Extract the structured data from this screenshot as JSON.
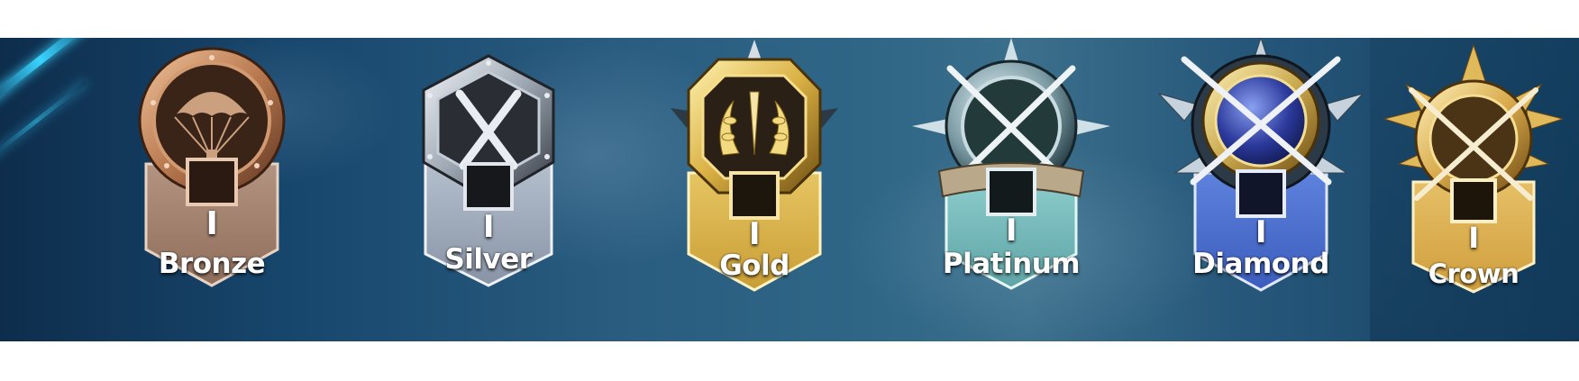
{
  "tiers": [
    {
      "label": "Bronze",
      "division": "I",
      "emblem": "parachute-icon",
      "colors": {
        "light": "#e9b890",
        "mid": "#b9794f",
        "dark": "#5d3421",
        "tail": "#9c7b66"
      }
    },
    {
      "label": "Silver",
      "division": "I",
      "emblem": "crossed-daggers-icon",
      "colors": {
        "light": "#e9edf2",
        "mid": "#9aa4b0",
        "dark": "#3b4048",
        "tail": "#9ba8b9"
      }
    },
    {
      "label": "Gold",
      "division": "I",
      "emblem": "laurel-icon",
      "colors": {
        "light": "#fff0a6",
        "mid": "#d9b043",
        "dark": "#6f4f12",
        "tail": "#d6b24e"
      }
    },
    {
      "label": "Platinum",
      "division": "I",
      "emblem": "crossed-rifles-icon",
      "colors": {
        "light": "#d9eef2",
        "mid": "#7b9aa3",
        "dark": "#203a42",
        "tail": "#79b9bb"
      }
    },
    {
      "label": "Diamond",
      "division": "I",
      "emblem": "crossed-rifles-gem-icon",
      "colors": {
        "light": "#f6e6a8",
        "mid": "#5d77c8",
        "dark": "#1b2a66",
        "tail": "#4c6fcf"
      }
    },
    {
      "label": "Crown",
      "division": "I",
      "emblem": "crossed-rifles-crown-icon",
      "colors": {
        "light": "#fff0b0",
        "mid": "#d8a94a",
        "dark": "#6a4612",
        "tail": "#dcae55"
      }
    }
  ]
}
